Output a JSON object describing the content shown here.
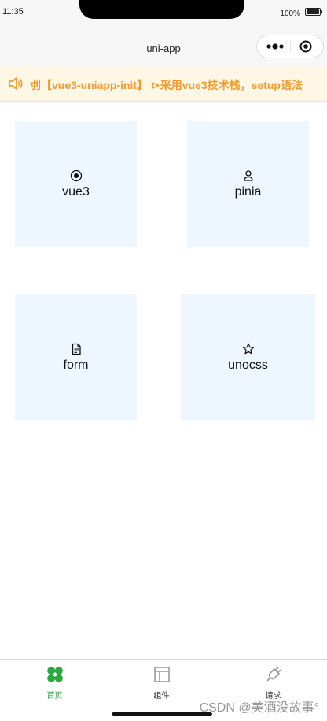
{
  "status_bar": {
    "time": "11:35",
    "battery_percent": "100%"
  },
  "navbar": {
    "title": "uni-app"
  },
  "notice": {
    "text": "刌【vue3-uniapp-init】 ⊳采用vue3技术栈，setup语法"
  },
  "tiles": [
    {
      "label": "vue3",
      "icon": "radio-dot-icon"
    },
    {
      "label": "pinia",
      "icon": "user-icon"
    },
    {
      "label": "form",
      "icon": "document-icon"
    },
    {
      "label": "unocss",
      "icon": "star-icon"
    }
  ],
  "tabbar": {
    "items": [
      {
        "label": "首页",
        "icon": "home-grid-icon",
        "active": true
      },
      {
        "label": "组件",
        "icon": "layout-icon",
        "active": false
      },
      {
        "label": "请求",
        "icon": "plug-icon",
        "active": false
      }
    ]
  },
  "watermark": "CSDN @美酒没故事°",
  "colors": {
    "accent_green": "#2aa842",
    "notice_orange": "#f39a2c",
    "notice_bg": "#fff7e6",
    "tile_bg": "#eef7ff"
  }
}
